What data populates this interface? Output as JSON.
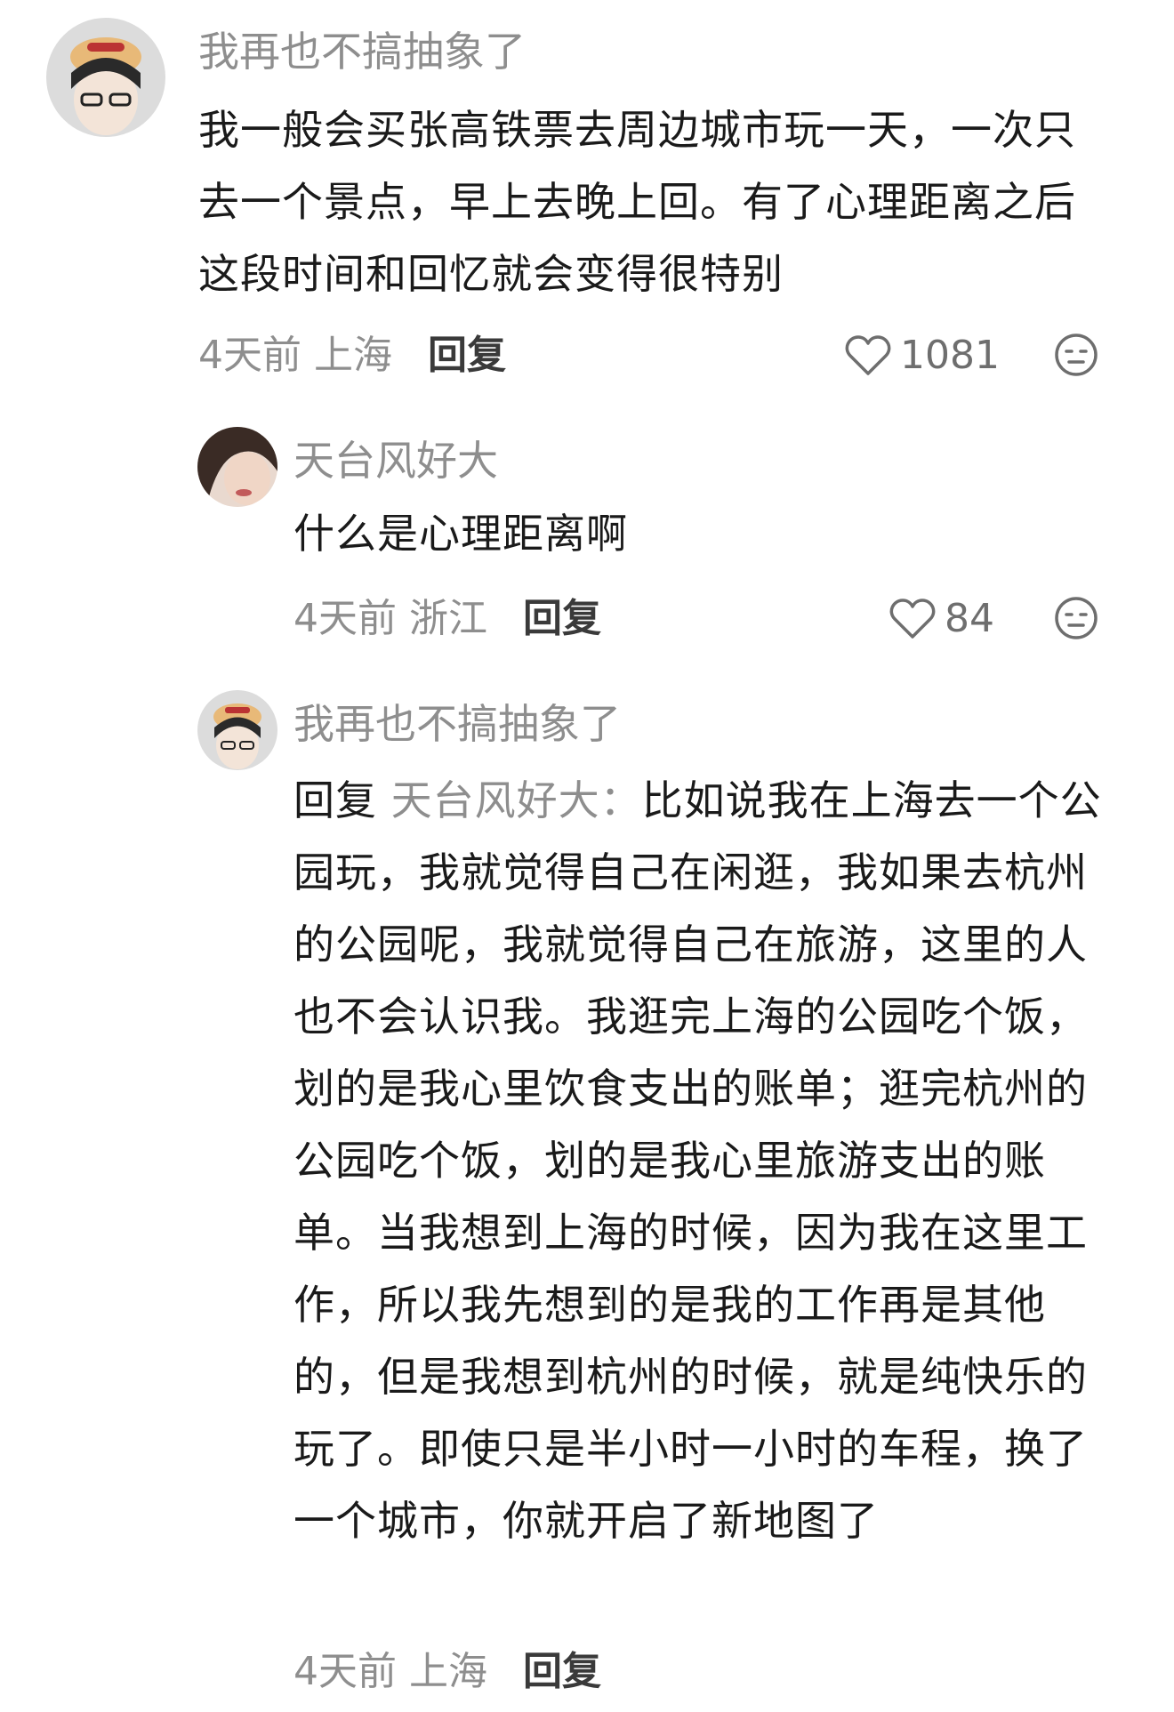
{
  "comments": [
    {
      "username": "我再也不搞抽象了",
      "text": "我一般会买张高铁票去周边城市玩一天，一次只去一个景点，早上去晚上回。有了心理距离之后这段时间和回忆就会变得很特别",
      "time": "4天前",
      "location": "上海",
      "reply_label": "回复",
      "likes": "1081"
    },
    {
      "username": "天台风好大",
      "text": "什么是心理距离啊",
      "time": "4天前",
      "location": "浙江",
      "reply_label": "回复",
      "likes": "84"
    },
    {
      "username": "我再也不搞抽象了",
      "reply_prefix": "回复",
      "reply_target": "天台风好大：",
      "text": "比如说我在上海去一个公园玩，我就觉得自己在闲逛，我如果去杭州的公园呢，我就觉得自己在旅游，这里的人也不会认识我。我逛完上海的公园吃个饭，划的是我心里饮食支出的账单；逛完杭州的公园吃个饭，划的是我心里旅游支出的账单。当我想到上海的时候，因为我在这里工作，所以我先想到的是我的工作再是其他的，但是我想到杭州的时候，就是纯快乐的玩了。即使只是半小时一小时的车程，换了一个城市，你就开启了新地图了",
      "time": "4天前",
      "location": "上海",
      "reply_label": "回复"
    }
  ],
  "icons": {
    "like": "heart-outline-icon",
    "dislike": "meh-face-icon"
  },
  "colors": {
    "username": "#8e8e8e",
    "text": "#1a1a1a",
    "meta": "#8e8e8e"
  }
}
